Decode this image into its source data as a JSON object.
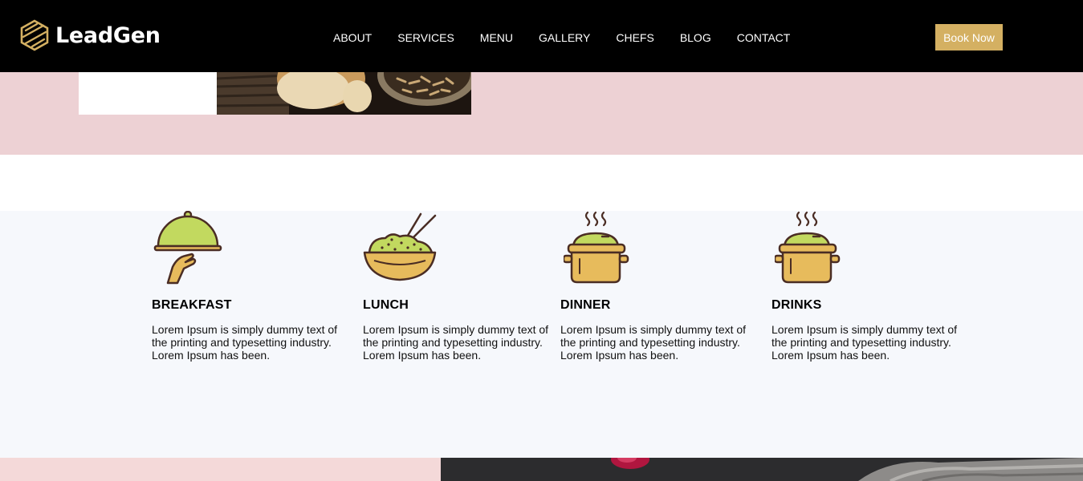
{
  "brand": {
    "name": "LeadGen",
    "accent_color": "#d4b062"
  },
  "nav": {
    "items": [
      {
        "label": "ABOUT"
      },
      {
        "label": "SERVICES"
      },
      {
        "label": "MENU"
      },
      {
        "label": "GALLERY"
      },
      {
        "label": "CHEFS"
      },
      {
        "label": "BLOG"
      },
      {
        "label": "CONTACT"
      }
    ],
    "cta_label": "Book Now"
  },
  "hero": {
    "background_color": "#edd1d4",
    "image_icon": "food-photo"
  },
  "services": {
    "background_color": "#f6f8fc",
    "items": [
      {
        "title": "BREAKFAST",
        "description": "Lorem Ipsum is simply dummy text of the printing and typesetting industry. Lorem Ipsum has been.",
        "icon": "cloche-icon"
      },
      {
        "title": "LUNCH",
        "description": "Lorem Ipsum is simply dummy text of the printing and typesetting industry. Lorem Ipsum has been.",
        "icon": "rice-bowl-icon"
      },
      {
        "title": "DINNER",
        "description": "Lorem Ipsum is simply dummy text of the printing and typesetting industry. Lorem Ipsum has been.",
        "icon": "cooking-pot-icon"
      },
      {
        "title": "DRINKS",
        "description": "Lorem Ipsum is simply dummy text of the printing and typesetting industry. Lorem Ipsum has been.",
        "icon": "cooking-pot-icon"
      }
    ]
  },
  "colors": {
    "icon_green": "#c2d95f",
    "icon_yellow": "#e7bb5c",
    "icon_outline": "#4a2d24"
  }
}
